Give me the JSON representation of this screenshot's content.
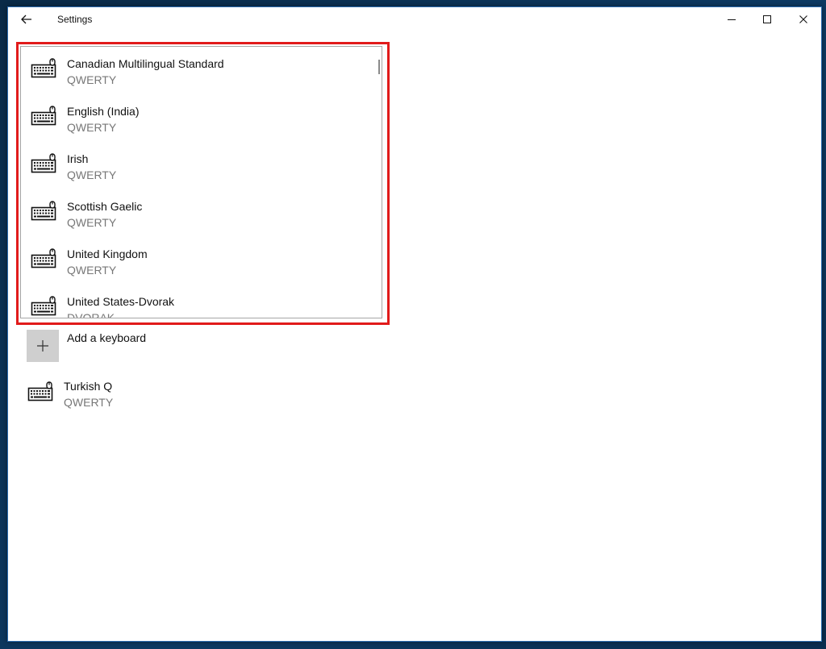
{
  "window": {
    "title": "Settings"
  },
  "keyboard_list": {
    "items": [
      {
        "name": "Canadian Multilingual Standard",
        "layout": "QWERTY"
      },
      {
        "name": "English (India)",
        "layout": "QWERTY"
      },
      {
        "name": "Irish",
        "layout": "QWERTY"
      },
      {
        "name": "Scottish Gaelic",
        "layout": "QWERTY"
      },
      {
        "name": "United Kingdom",
        "layout": "QWERTY"
      },
      {
        "name": "United States-Dvorak",
        "layout": "DVORAK"
      }
    ]
  },
  "add_keyboard": {
    "label": "Add a keyboard"
  },
  "installed_keyboard": {
    "name": "Turkish Q",
    "layout": "QWERTY"
  },
  "icons": {
    "back": "back-arrow-icon",
    "minimize": "minimize-icon",
    "maximize": "maximize-icon",
    "close": "close-icon",
    "keyboard": "keyboard-icon",
    "add": "plus-icon"
  },
  "colors": {
    "highlight": "#e11b1b",
    "add_tile": "#cfcfcf",
    "secondary_text": "#777777"
  }
}
